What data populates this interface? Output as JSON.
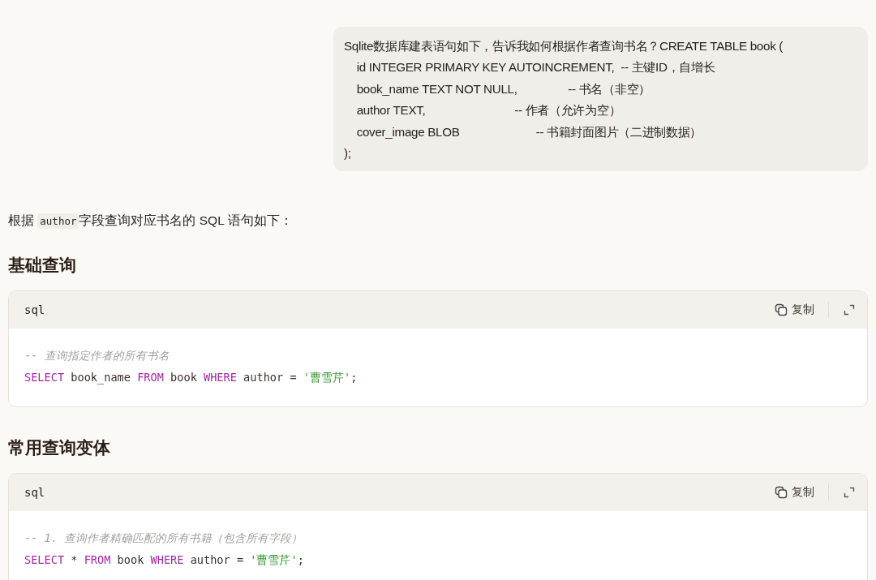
{
  "user_message": {
    "lines": [
      "Sqlite数据库建表语句如下，告诉我如何根据作者查询书名？CREATE TABLE book (",
      "    id INTEGER PRIMARY KEY AUTOINCREMENT,  -- 主键ID，自增长",
      "    book_name TEXT NOT NULL,                -- 书名（非空）",
      "    author TEXT,                            -- 作者（允许为空）",
      "    cover_image BLOB                        -- 书籍封面图片（二进制数据）",
      ");"
    ]
  },
  "intro": {
    "before": "根据 ",
    "code": "author",
    "after": "字段查询对应书名的 SQL 语句如下："
  },
  "sections": [
    {
      "heading": "基础查询",
      "code_block": {
        "language": "sql",
        "copy_label": "复制",
        "lines": [
          [
            {
              "kind": "comment",
              "text": "-- 查询指定作者的所有书名"
            }
          ],
          [
            {
              "kind": "keyword",
              "text": "SELECT"
            },
            {
              "kind": "plain",
              "text": " book_name "
            },
            {
              "kind": "keyword",
              "text": "FROM"
            },
            {
              "kind": "plain",
              "text": " book "
            },
            {
              "kind": "keyword",
              "text": "WHERE"
            },
            {
              "kind": "plain",
              "text": " author = "
            },
            {
              "kind": "string",
              "text": "'曹雪芹'"
            },
            {
              "kind": "plain",
              "text": ";"
            }
          ]
        ]
      }
    },
    {
      "heading": "常用查询变体",
      "code_block": {
        "language": "sql",
        "copy_label": "复制",
        "lines": [
          [
            {
              "kind": "comment",
              "text": "-- 1. 查询作者精确匹配的所有书籍（包含所有字段）"
            }
          ],
          [
            {
              "kind": "keyword",
              "text": "SELECT"
            },
            {
              "kind": "plain",
              "text": " * "
            },
            {
              "kind": "keyword",
              "text": "FROM"
            },
            {
              "kind": "plain",
              "text": " book "
            },
            {
              "kind": "keyword",
              "text": "WHERE"
            },
            {
              "kind": "plain",
              "text": " author = "
            },
            {
              "kind": "string",
              "text": "'曹雪芹'"
            },
            {
              "kind": "plain",
              "text": ";"
            }
          ]
        ]
      }
    }
  ]
}
